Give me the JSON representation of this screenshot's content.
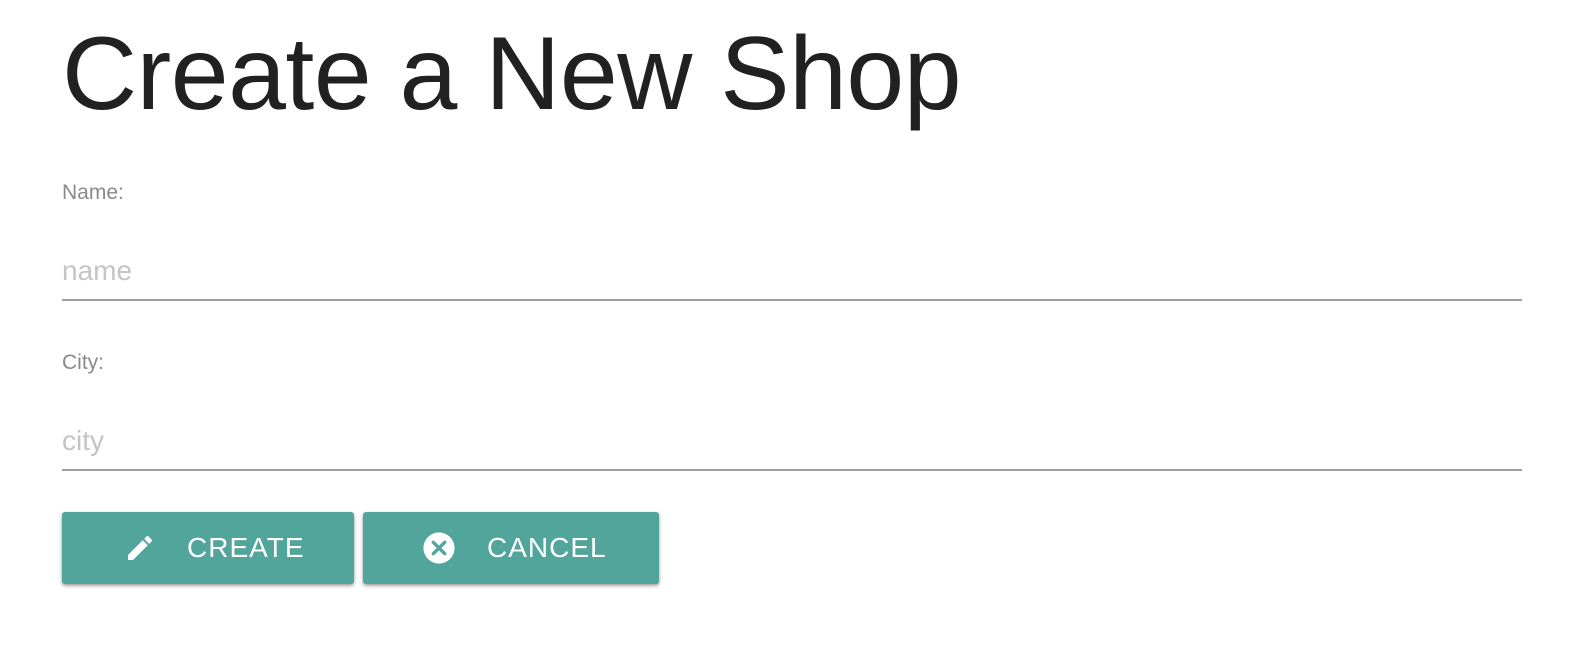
{
  "page": {
    "title": "Create a New Shop"
  },
  "form": {
    "name": {
      "label": "Name:",
      "placeholder": "name",
      "value": ""
    },
    "city": {
      "label": "City:",
      "placeholder": "city",
      "value": ""
    }
  },
  "actions": {
    "create": {
      "label": "CREATE",
      "icon": "pencil-icon"
    },
    "cancel": {
      "label": "CANCEL",
      "icon": "close-circle-icon"
    }
  },
  "colors": {
    "button_background": "#52a59b",
    "button_text": "#ffffff",
    "title_text": "#212121",
    "label_text": "#8a8a8a",
    "placeholder_text": "#c4c4c4",
    "input_underline": "#9e9e9e"
  }
}
